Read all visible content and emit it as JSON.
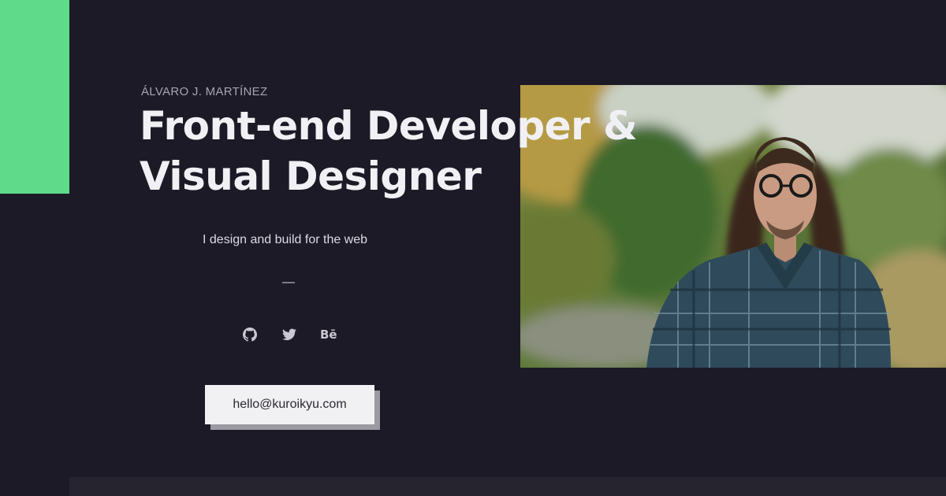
{
  "hero": {
    "name": "ÁLVARO J. MARTÍNEZ",
    "headline_line1": "Front-end Developer &",
    "headline_line2": "Visual Designer",
    "tagline": "I design and build for the web",
    "divider": "—"
  },
  "socials": [
    {
      "icon": "github-icon"
    },
    {
      "icon": "twitter-icon"
    },
    {
      "icon": "behance-icon",
      "label": "Bē"
    }
  ],
  "contact": {
    "email": "hello@kuroikyu.com"
  },
  "colors": {
    "background": "#1c1a26",
    "accent": "#5fd98a",
    "text": "#f1f0f4",
    "muted": "#a7a4b0"
  }
}
